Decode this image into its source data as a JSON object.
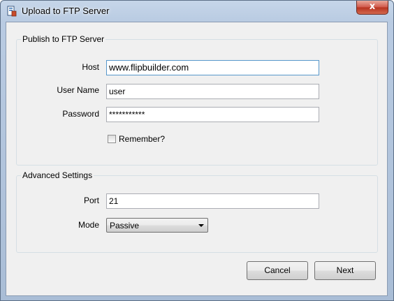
{
  "window": {
    "title": "Upload to FTP Server",
    "close_glyph": "x"
  },
  "publish_group": {
    "title": "Publish to FTP Server",
    "host_label": "Host",
    "host_value": "www.flipbuilder.com",
    "username_label": "User Name",
    "username_value": "user",
    "password_label": "Password",
    "password_value": "***********",
    "remember_label": "Remember?",
    "remember_checked": false
  },
  "advanced_group": {
    "title": "Advanced Settings",
    "port_label": "Port",
    "port_value": "21",
    "mode_label": "Mode",
    "mode_value": "Passive"
  },
  "buttons": {
    "cancel": "Cancel",
    "next": "Next"
  },
  "icons": {
    "app": "ftp-upload-icon",
    "close": "close-icon",
    "dropdown": "chevron-down-icon"
  }
}
